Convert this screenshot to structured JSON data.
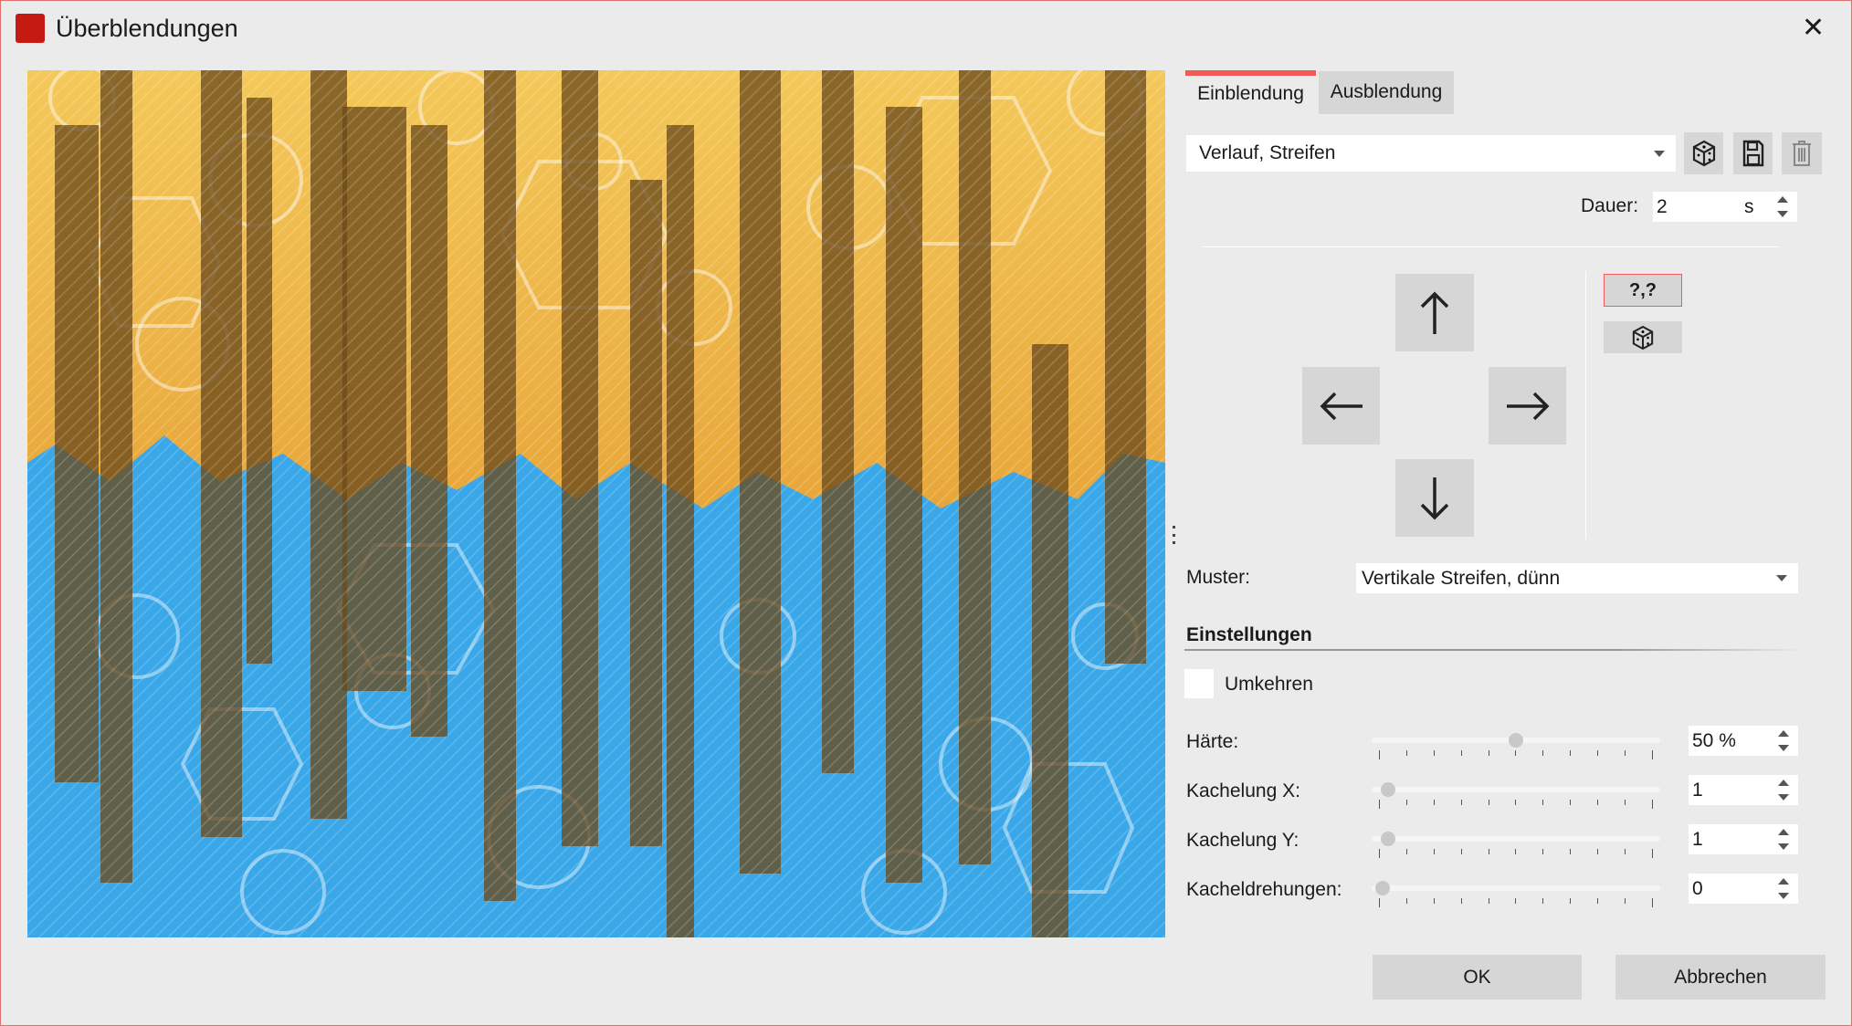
{
  "window": {
    "title": "Überblendungen",
    "close_icon": "close-icon"
  },
  "tabs": [
    {
      "label": "Einblendung",
      "active": true
    },
    {
      "label": "Ausblendung",
      "active": false
    }
  ],
  "accent": "#f25a57",
  "preset": {
    "value": "Verlauf, Streifen",
    "icons": [
      "dice-icon",
      "save-icon",
      "trash-icon"
    ]
  },
  "dauer": {
    "label": "Dauer:",
    "value": "2",
    "unit": "s"
  },
  "directions": [
    "arrow-up",
    "arrow-left",
    "arrow-right",
    "arrow-down"
  ],
  "side_buttons": {
    "random_label": "?,?",
    "dice": "dice-icon"
  },
  "muster": {
    "label": "Muster:",
    "value": "Vertikale Streifen, dünn"
  },
  "settings": {
    "heading": "Einstellungen",
    "umkehren": {
      "label": "Umkehren",
      "checked": false
    },
    "sliders": [
      {
        "label": "Härte:",
        "value": "50 %",
        "level": 0.5
      },
      {
        "label": "Kachelung X:",
        "value": "1",
        "level": 0.02
      },
      {
        "label": "Kachelung Y:",
        "value": "1",
        "level": 0.02
      },
      {
        "label": "Kacheldrehungen:",
        "value": "0",
        "level": 0
      }
    ]
  },
  "buttons": {
    "ok": "OK",
    "cancel": "Abbrechen"
  }
}
